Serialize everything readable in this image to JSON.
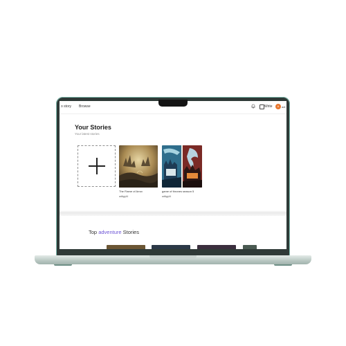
{
  "nav": {
    "left_link": "o story",
    "browse_link": "Browse",
    "write_label": "Write",
    "avatar_initial": "A",
    "user_name": "adi"
  },
  "your_stories": {
    "title": "Your Stories",
    "subtitle": "Your latest stories"
  },
  "stories": [
    {
      "title": "The Flame of Arrov",
      "author": "adityg44"
    },
    {
      "title": "game of thrones season 5",
      "author": "adityg44"
    }
  ],
  "top_section": {
    "prefix": "Top",
    "genre": "adventure",
    "suffix": "Stories"
  },
  "colors": {
    "accent": "#6d55d6",
    "avatar": "#e8772e",
    "frame": "#7fbdb0"
  }
}
